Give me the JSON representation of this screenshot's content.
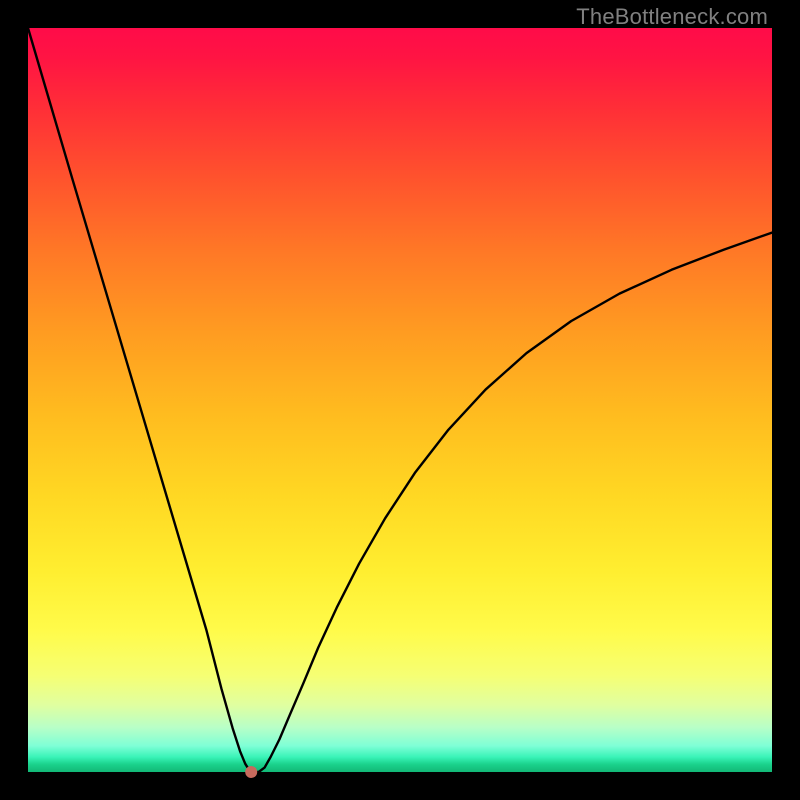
{
  "watermark": "TheBottleneck.com",
  "colors": {
    "frame": "#000000",
    "curve": "#000000",
    "marker_fill": "#c76a5d",
    "marker_stroke": "#a04038"
  },
  "chart_data": {
    "type": "line",
    "title": "",
    "xlabel": "",
    "ylabel": "",
    "xlim": [
      0,
      100
    ],
    "ylim": [
      0,
      100
    ],
    "grid": false,
    "legend": false,
    "x": [
      0,
      3,
      6,
      9,
      12,
      15,
      18,
      21,
      24,
      26,
      27.5,
      28.5,
      29.2,
      29.7,
      30,
      31,
      31.8,
      32.6,
      33.8,
      35.2,
      37,
      39,
      41.5,
      44.5,
      48,
      52,
      56.5,
      61.5,
      67,
      73,
      79.5,
      86.5,
      93.5,
      100
    ],
    "values": [
      100,
      89.8,
      79.6,
      69.5,
      59.4,
      49.3,
      39.2,
      29.1,
      19,
      11.2,
      5.9,
      2.8,
      1.1,
      0.3,
      0,
      0,
      0.6,
      2,
      4.4,
      7.7,
      11.9,
      16.7,
      22.1,
      28,
      34.1,
      40.2,
      46,
      51.4,
      56.3,
      60.6,
      64.3,
      67.5,
      70.2,
      72.5
    ],
    "marker": {
      "x": 30,
      "y": 0
    },
    "note": "Values are percent of plot area; (0,0) is bottom-left. Minimum (optimum) near x≈30."
  }
}
